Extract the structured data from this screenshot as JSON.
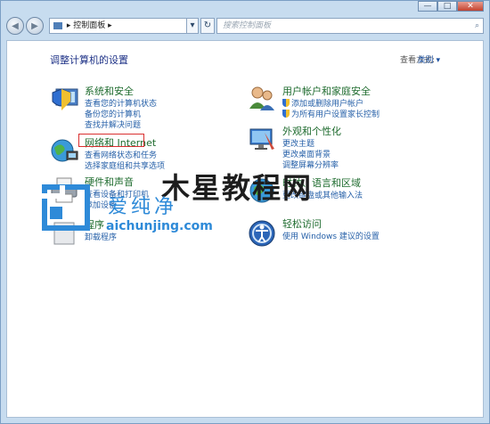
{
  "window": {
    "min_label": "—",
    "max_label": "□",
    "close_label": "✕"
  },
  "nav": {
    "back_label": "◀",
    "forward_label": "▶",
    "breadcrumb": "控制面板",
    "sep1": "▸",
    "sep2": "▸",
    "dropdown": "▾",
    "refresh": "↻",
    "search_placeholder": "搜索控制面板",
    "search_icon": "magnifier-icon"
  },
  "header": {
    "title": "调整计算机的设置",
    "view_by_label": "查看方式:",
    "view_by_value": "类别 ▾"
  },
  "categories": [
    {
      "name": "系统和安全",
      "icon": "shield-computer-icon",
      "links": [
        "查看您的计算机状态",
        "备份您的计算机",
        "查找并解决问题"
      ]
    },
    {
      "name": "网络和 Internet",
      "icon": "network-globe-icon",
      "links": [
        "查看网络状态和任务",
        "选择家庭组和共享选项"
      ]
    },
    {
      "name": "硬件和声音",
      "icon": "printer-icon",
      "links": [
        "查看设备和打印机",
        "添加设备"
      ]
    },
    {
      "name": "程序",
      "icon": "programs-icon",
      "links": [
        "卸载程序"
      ]
    },
    {
      "name": "用户帐户和家庭安全",
      "icon": "users-icon",
      "links": [
        "添加或删除用户帐户",
        "为所有用户设置家长控制"
      ]
    },
    {
      "name": "外观和个性化",
      "icon": "display-icon",
      "links": [
        "更改主题",
        "更改桌面背景",
        "调整屏幕分辨率"
      ]
    },
    {
      "name": "时钟、语言和区域",
      "icon": "clock-globe-icon",
      "links": [
        "更改键盘或其他输入法"
      ]
    },
    {
      "name": "轻松访问",
      "icon": "ease-access-icon",
      "links": [
        "使用 Windows 建议的设置"
      ]
    }
  ],
  "watermark": {
    "text": "木星教程网",
    "logo_text": "爱纯净",
    "logo_url": "aichunjing.com"
  },
  "colors": {
    "highlight_border": "#d93030",
    "link": "#2660a8",
    "category_heading": "#1e6b2e",
    "logo_blue": "#2e8ad8"
  }
}
